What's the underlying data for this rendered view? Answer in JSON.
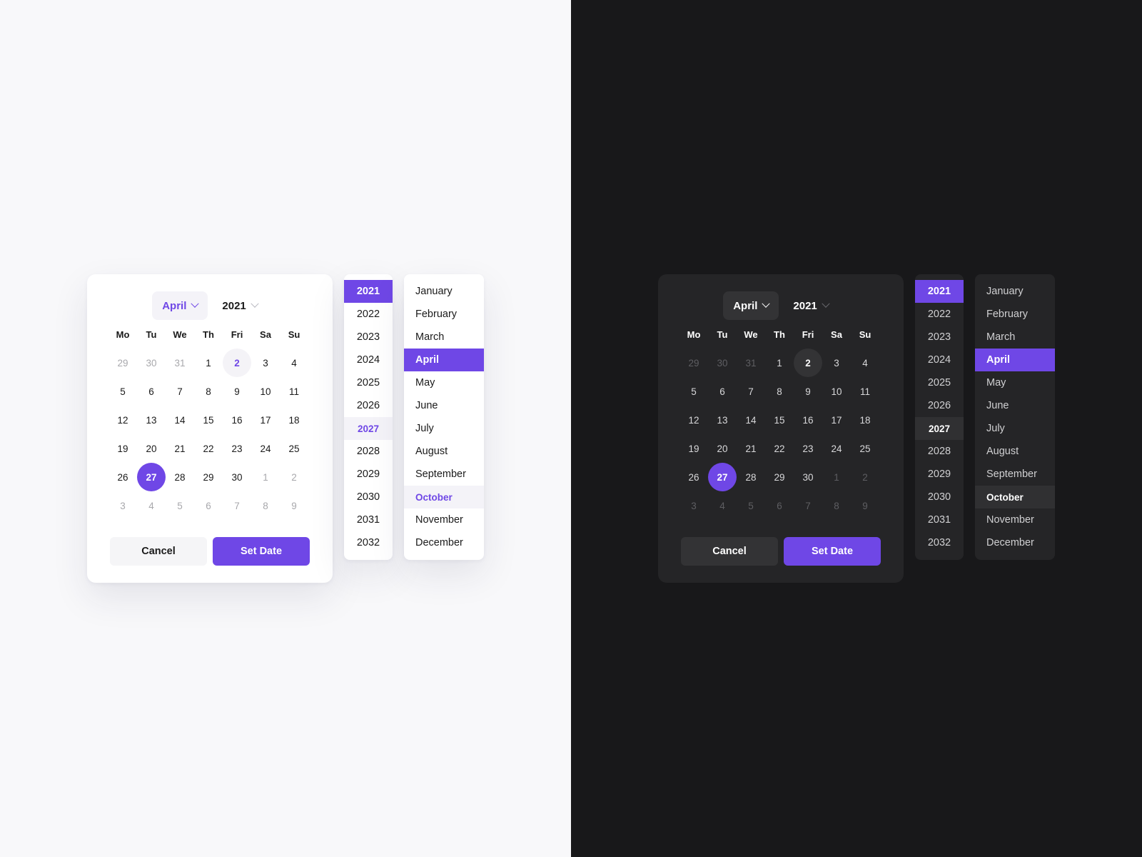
{
  "theme_colors": {
    "accent": "#6f47e6",
    "light_bg": "#f8f8fa",
    "dark_bg": "#18181a",
    "dark_card": "#252527"
  },
  "picker": {
    "month_selector": {
      "label": "April",
      "icon": "chevron-down-icon"
    },
    "year_selector": {
      "label": "2021",
      "icon": "chevron-down-icon"
    },
    "weekdays": [
      "Mo",
      "Tu",
      "We",
      "Th",
      "Fri",
      "Sa",
      "Su"
    ],
    "days": [
      {
        "label": "29",
        "state": "muted"
      },
      {
        "label": "30",
        "state": "muted"
      },
      {
        "label": "31",
        "state": "muted"
      },
      {
        "label": "1",
        "state": ""
      },
      {
        "label": "2",
        "state": "today"
      },
      {
        "label": "3",
        "state": ""
      },
      {
        "label": "4",
        "state": ""
      },
      {
        "label": "5",
        "state": ""
      },
      {
        "label": "6",
        "state": ""
      },
      {
        "label": "7",
        "state": ""
      },
      {
        "label": "8",
        "state": ""
      },
      {
        "label": "9",
        "state": ""
      },
      {
        "label": "10",
        "state": ""
      },
      {
        "label": "11",
        "state": ""
      },
      {
        "label": "12",
        "state": ""
      },
      {
        "label": "13",
        "state": ""
      },
      {
        "label": "14",
        "state": ""
      },
      {
        "label": "15",
        "state": ""
      },
      {
        "label": "16",
        "state": ""
      },
      {
        "label": "17",
        "state": ""
      },
      {
        "label": "18",
        "state": ""
      },
      {
        "label": "19",
        "state": ""
      },
      {
        "label": "20",
        "state": ""
      },
      {
        "label": "21",
        "state": ""
      },
      {
        "label": "22",
        "state": ""
      },
      {
        "label": "23",
        "state": ""
      },
      {
        "label": "24",
        "state": ""
      },
      {
        "label": "25",
        "state": ""
      },
      {
        "label": "26",
        "state": ""
      },
      {
        "label": "27",
        "state": "selected"
      },
      {
        "label": "28",
        "state": ""
      },
      {
        "label": "29",
        "state": ""
      },
      {
        "label": "30",
        "state": ""
      },
      {
        "label": "1",
        "state": "muted"
      },
      {
        "label": "2",
        "state": "muted"
      },
      {
        "label": "3",
        "state": "muted"
      },
      {
        "label": "4",
        "state": "muted"
      },
      {
        "label": "5",
        "state": "muted"
      },
      {
        "label": "6",
        "state": "muted"
      },
      {
        "label": "7",
        "state": "muted"
      },
      {
        "label": "8",
        "state": "muted"
      },
      {
        "label": "9",
        "state": "muted"
      }
    ],
    "cancel_label": "Cancel",
    "set_date_label": "Set Date"
  },
  "year_list": {
    "items": [
      "2021",
      "2022",
      "2023",
      "2024",
      "2025",
      "2026",
      "2027",
      "2028",
      "2029",
      "2030",
      "2031",
      "2032"
    ],
    "active": "2021",
    "hover": "2027"
  },
  "month_list": {
    "items": [
      "January",
      "February",
      "March",
      "April",
      "May",
      "June",
      "July",
      "August",
      "September",
      "October",
      "November",
      "December"
    ],
    "active": "April",
    "hover": "October"
  }
}
